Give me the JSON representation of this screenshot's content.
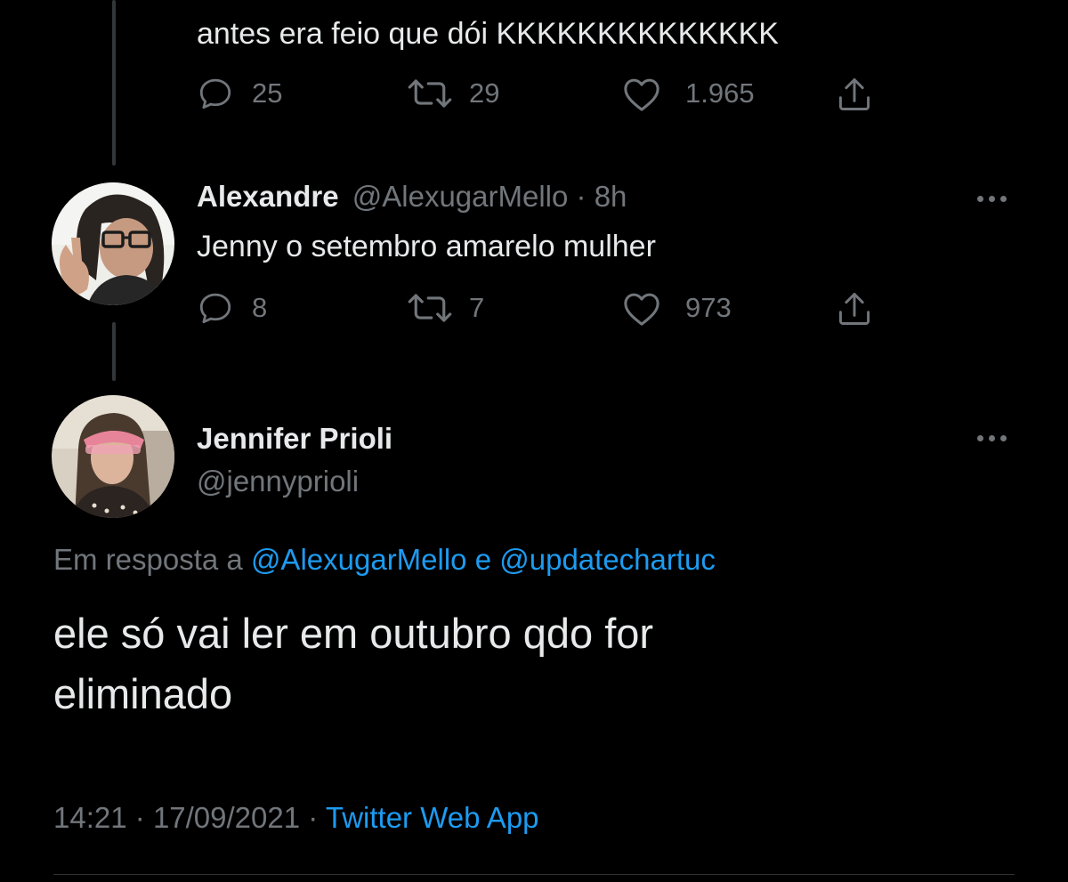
{
  "colors": {
    "background": "#000000",
    "text": "#e7e9ea",
    "muted": "#71767b",
    "link": "#1d9bf0",
    "thread_line": "#333639"
  },
  "tweet1": {
    "text": "antes era feio que dói KKKKKKKKKKKKKK",
    "replies": "25",
    "retweets": "29",
    "likes": "1.965"
  },
  "tweet2": {
    "name": "Alexandre",
    "handle": "@AlexugarMello",
    "separator": "·",
    "time": "8h",
    "text": "Jenny o setembro amarelo mulher",
    "replies": "8",
    "retweets": "7",
    "likes": "973"
  },
  "main_tweet": {
    "name": "Jennifer Prioli",
    "handle": "@jennyprioli",
    "reply_prefix": "Em resposta a",
    "reply_user1": "@AlexugarMello",
    "reply_joiner": "e",
    "reply_user2": "@updatechartuc",
    "text": "ele só vai ler em outubro qdo for eliminado",
    "time": "14:21",
    "separator1": "·",
    "date": "17/09/2021",
    "separator2": "·",
    "source": "Twitter Web App"
  },
  "icons": {
    "reply": "reply-icon",
    "retweet": "retweet-icon",
    "like": "heart-icon",
    "share": "share-icon",
    "more": "more-options-icon"
  }
}
